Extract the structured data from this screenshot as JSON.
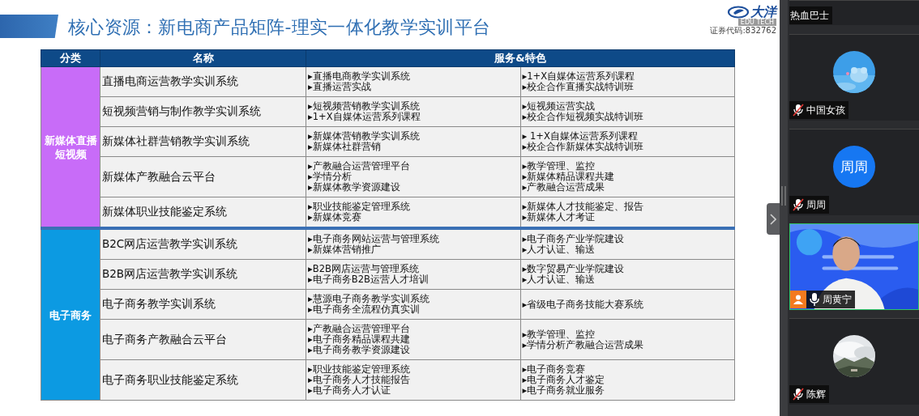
{
  "slide": {
    "title": "核心资源：新电商产品矩阵-理实一体化教学实训平台",
    "logo": {
      "brand": "大洋",
      "tag": "EDU TECH",
      "stock_code": "证券代码:832762"
    },
    "table": {
      "columns": [
        "分类",
        "名称",
        "服务&特色"
      ],
      "groups": [
        {
          "category": "新媒体直播短视频",
          "color": "#c86cf8",
          "rows": [
            {
              "name": "直播电商运营教学实训系统",
              "services": [
                "▸直播电商教学实训系统",
                "▸直播运营实战"
              ],
              "features": [
                "▸1+X自媒体运营系列课程",
                "▸校企合作直播实战特训班"
              ]
            },
            {
              "name": "短视频营销与制作教学实训系统",
              "services": [
                "▸短视频营销教学实训系统",
                "▸1+X自媒体运营系列课程"
              ],
              "features": [
                "▸短视频运营实战",
                "▸校企合作短视频实战特训班"
              ]
            },
            {
              "name": "新媒体社群营销教学实训系统",
              "services": [
                "▸新媒体营销教学实训系统",
                "▸新媒体社群营销"
              ],
              "features": [
                "▸ 1+X自媒体运营系列课程",
                "▸校企合作新媒体实战特训班"
              ]
            },
            {
              "name": "新媒体产教融合云平台",
              "services": [
                "▸产教融合运营管理平台",
                "▸学情分析",
                "▸新媒体教学资源建设"
              ],
              "features": [
                "▸教学管理、监控",
                "▸新媒体精品课程共建",
                "▸产教融合运营成果"
              ]
            },
            {
              "name": "新媒体职业技能鉴定系统",
              "services": [
                "▸职业技能鉴定管理系统",
                "▸新媒体竞赛"
              ],
              "features": [
                "▸新媒体人才技能鉴定、报告",
                "▸新媒体人才考证"
              ]
            }
          ]
        },
        {
          "category": "电子商务",
          "color": "#0c9ae2",
          "rows": [
            {
              "name": "B2C网店运营教学实训系统",
              "services": [
                "▸电子商务网站运营与管理系统",
                "▸新媒体营销推广"
              ],
              "features": [
                "▸电子商务产业学院建设",
                "▸人才认证、输送"
              ]
            },
            {
              "name": "B2B网店运营教学实训系统",
              "services": [
                " ▸B2B网店运营与管理系统",
                "▸电子商务B2B运营人才培训"
              ],
              "features": [
                "▸数字贸易产业学院建设",
                "▸人才认证、输送"
              ]
            },
            {
              "name": "电子商务教学实训系统",
              "services": [
                "▸慧源电子商务教学实训系统",
                "▸电子商务全流程仿真实训"
              ],
              "features": [
                "▸省级电子商务技能大赛系统"
              ]
            },
            {
              "name": "电子商务产教融合云平台",
              "services": [
                "▸产教融合运营管理平台",
                "▸电子商务精品课程共建",
                "▸电子商务教学资源建设"
              ],
              "features": [
                "▸教学管理、监控",
                "▸学情分析产教融合运营成果"
              ]
            },
            {
              "name": "电子商务职业技能鉴定系统",
              "services": [
                "▸职业技能鉴定管理系统",
                "▸电子商务人才技能报告",
                "▸电子商务人才认证"
              ],
              "features": [
                "▸电子商务竞赛",
                "▸电子商务人才鉴定",
                "▸电子商务就业服务"
              ]
            }
          ]
        }
      ]
    }
  },
  "participants": [
    {
      "name": "热血巴士",
      "kind": "cut",
      "host": false,
      "active": false
    },
    {
      "name": "中国女孩",
      "kind": "avatar",
      "muted": true,
      "host": false,
      "active": false
    },
    {
      "name": "周周",
      "kind": "initials",
      "initials": "周周",
      "muted": true,
      "host": false,
      "active": false
    },
    {
      "name": "周黄宁",
      "kind": "video",
      "muted": false,
      "host": true,
      "active": true
    },
    {
      "name": "陈辉",
      "kind": "landscape",
      "muted": true,
      "host": false,
      "active": false
    }
  ]
}
